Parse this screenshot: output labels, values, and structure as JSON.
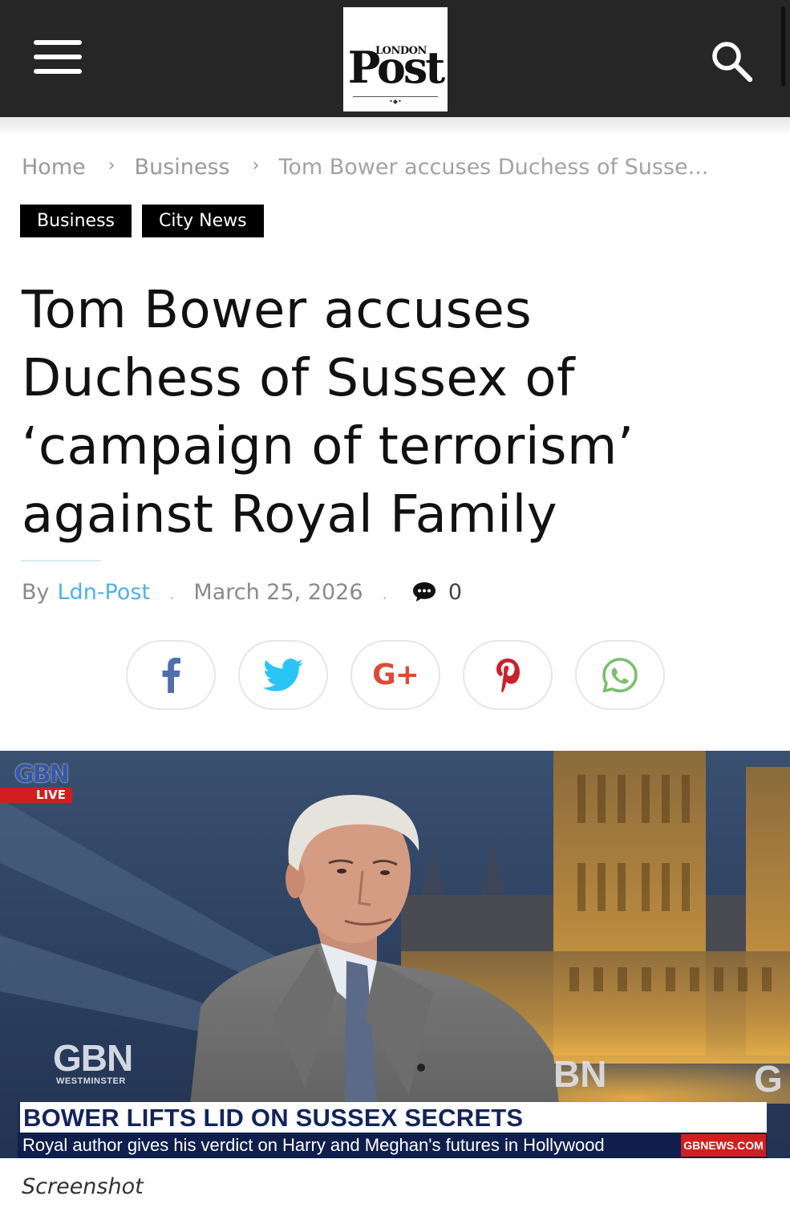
{
  "header": {
    "logo_small": "LONDON",
    "logo_big": "Post",
    "logo_ornament": "•◆•"
  },
  "breadcrumb": {
    "items": [
      "Home",
      "Business",
      "Tom Bower accuses Duchess of Susse..."
    ]
  },
  "tags": [
    "Business",
    "City News"
  ],
  "article": {
    "title": "Tom Bower accuses Duchess of Sussex of ‘campaign of terrorism’ against Royal Family",
    "by_label": "By",
    "author": "Ldn-Post",
    "separator": ".",
    "date": "March 25, 2026",
    "comment_count": "0"
  },
  "share": {
    "buttons": [
      "facebook",
      "twitter",
      "google-plus",
      "pinterest",
      "whatsapp"
    ],
    "google_plus_text": "G+"
  },
  "image": {
    "channel_logo": "GBN",
    "live_label": "LIVE",
    "wall_logo": "GBN",
    "wall_sub": "WESTMINSTER",
    "wall_logo_2": "BN",
    "wall_logo_3": "G",
    "headline": "BOWER LIFTS LID ON SUSSEX SECRETS",
    "subheadline": "Royal author gives his verdict on Harry and Meghan's futures in Hollywood",
    "url": "GBNEWS.COM"
  },
  "caption": "Screenshot",
  "colors": {
    "header_bg": "#262626",
    "accent_link": "#4db2ec",
    "tag_bg": "#000000",
    "gbn_red": "#d11f1f",
    "gbn_navy": "#0f1e4c"
  }
}
